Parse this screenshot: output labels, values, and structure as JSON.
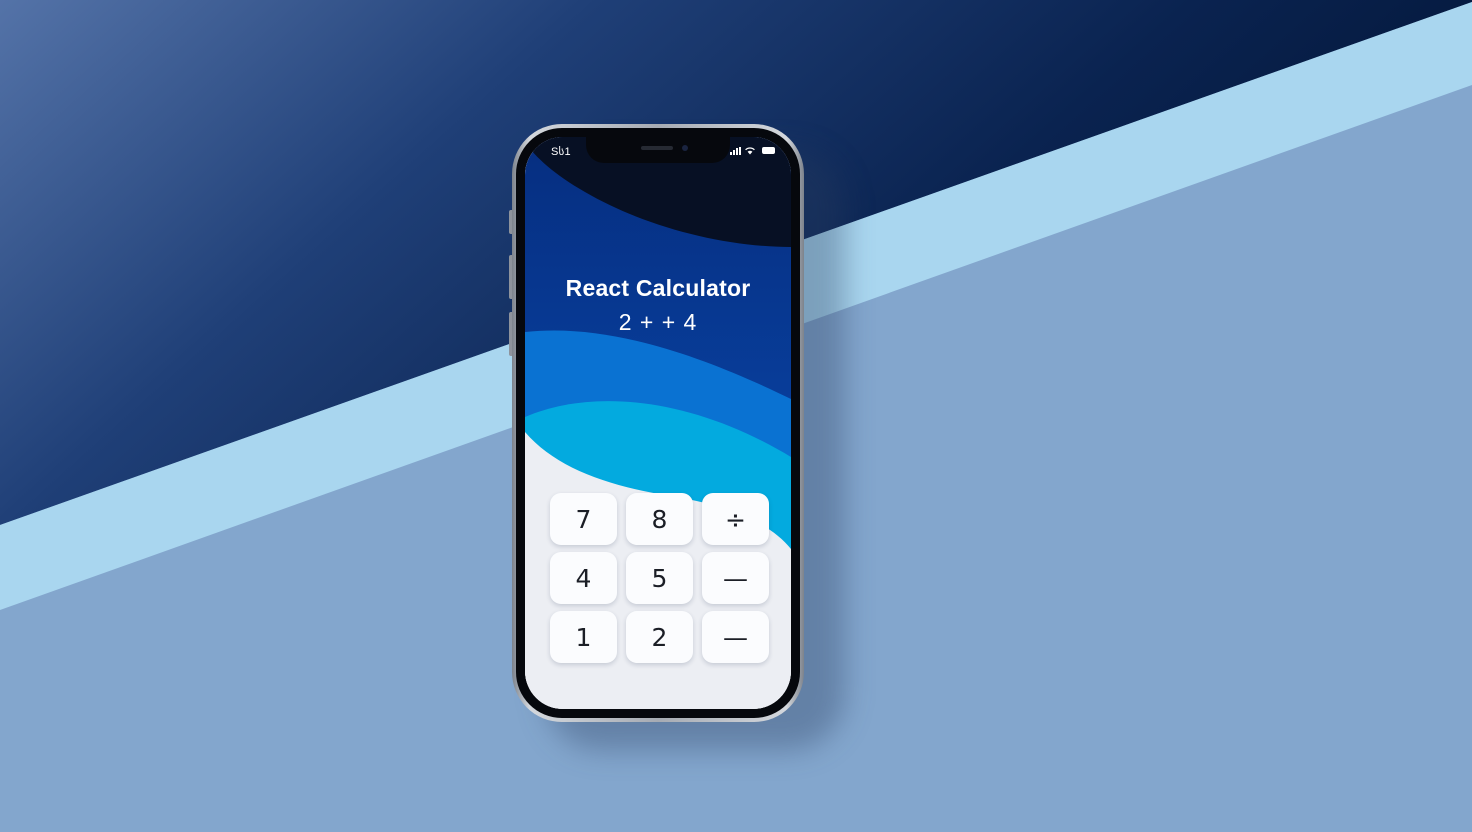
{
  "status_bar": {
    "carrier": "Sს1"
  },
  "app": {
    "title": "React Calculator",
    "expression": "2 + + 4"
  },
  "keypad": {
    "keys": [
      "7",
      "8",
      "÷",
      "4",
      "5",
      "—",
      "1",
      "2",
      "—"
    ]
  },
  "colors": {
    "background_dark": "#0b2450",
    "background_light_band": "#a9d6ef",
    "background_base": "#83a6cd",
    "screen_top": "#061127",
    "screen_mid": "#07348a",
    "wave_blue": "#0a6fcf",
    "wave_cyan": "#02aee0",
    "key_background": "#fbfcfe"
  },
  "icons": [
    "signal-icon",
    "wifi-icon",
    "battery-icon"
  ]
}
